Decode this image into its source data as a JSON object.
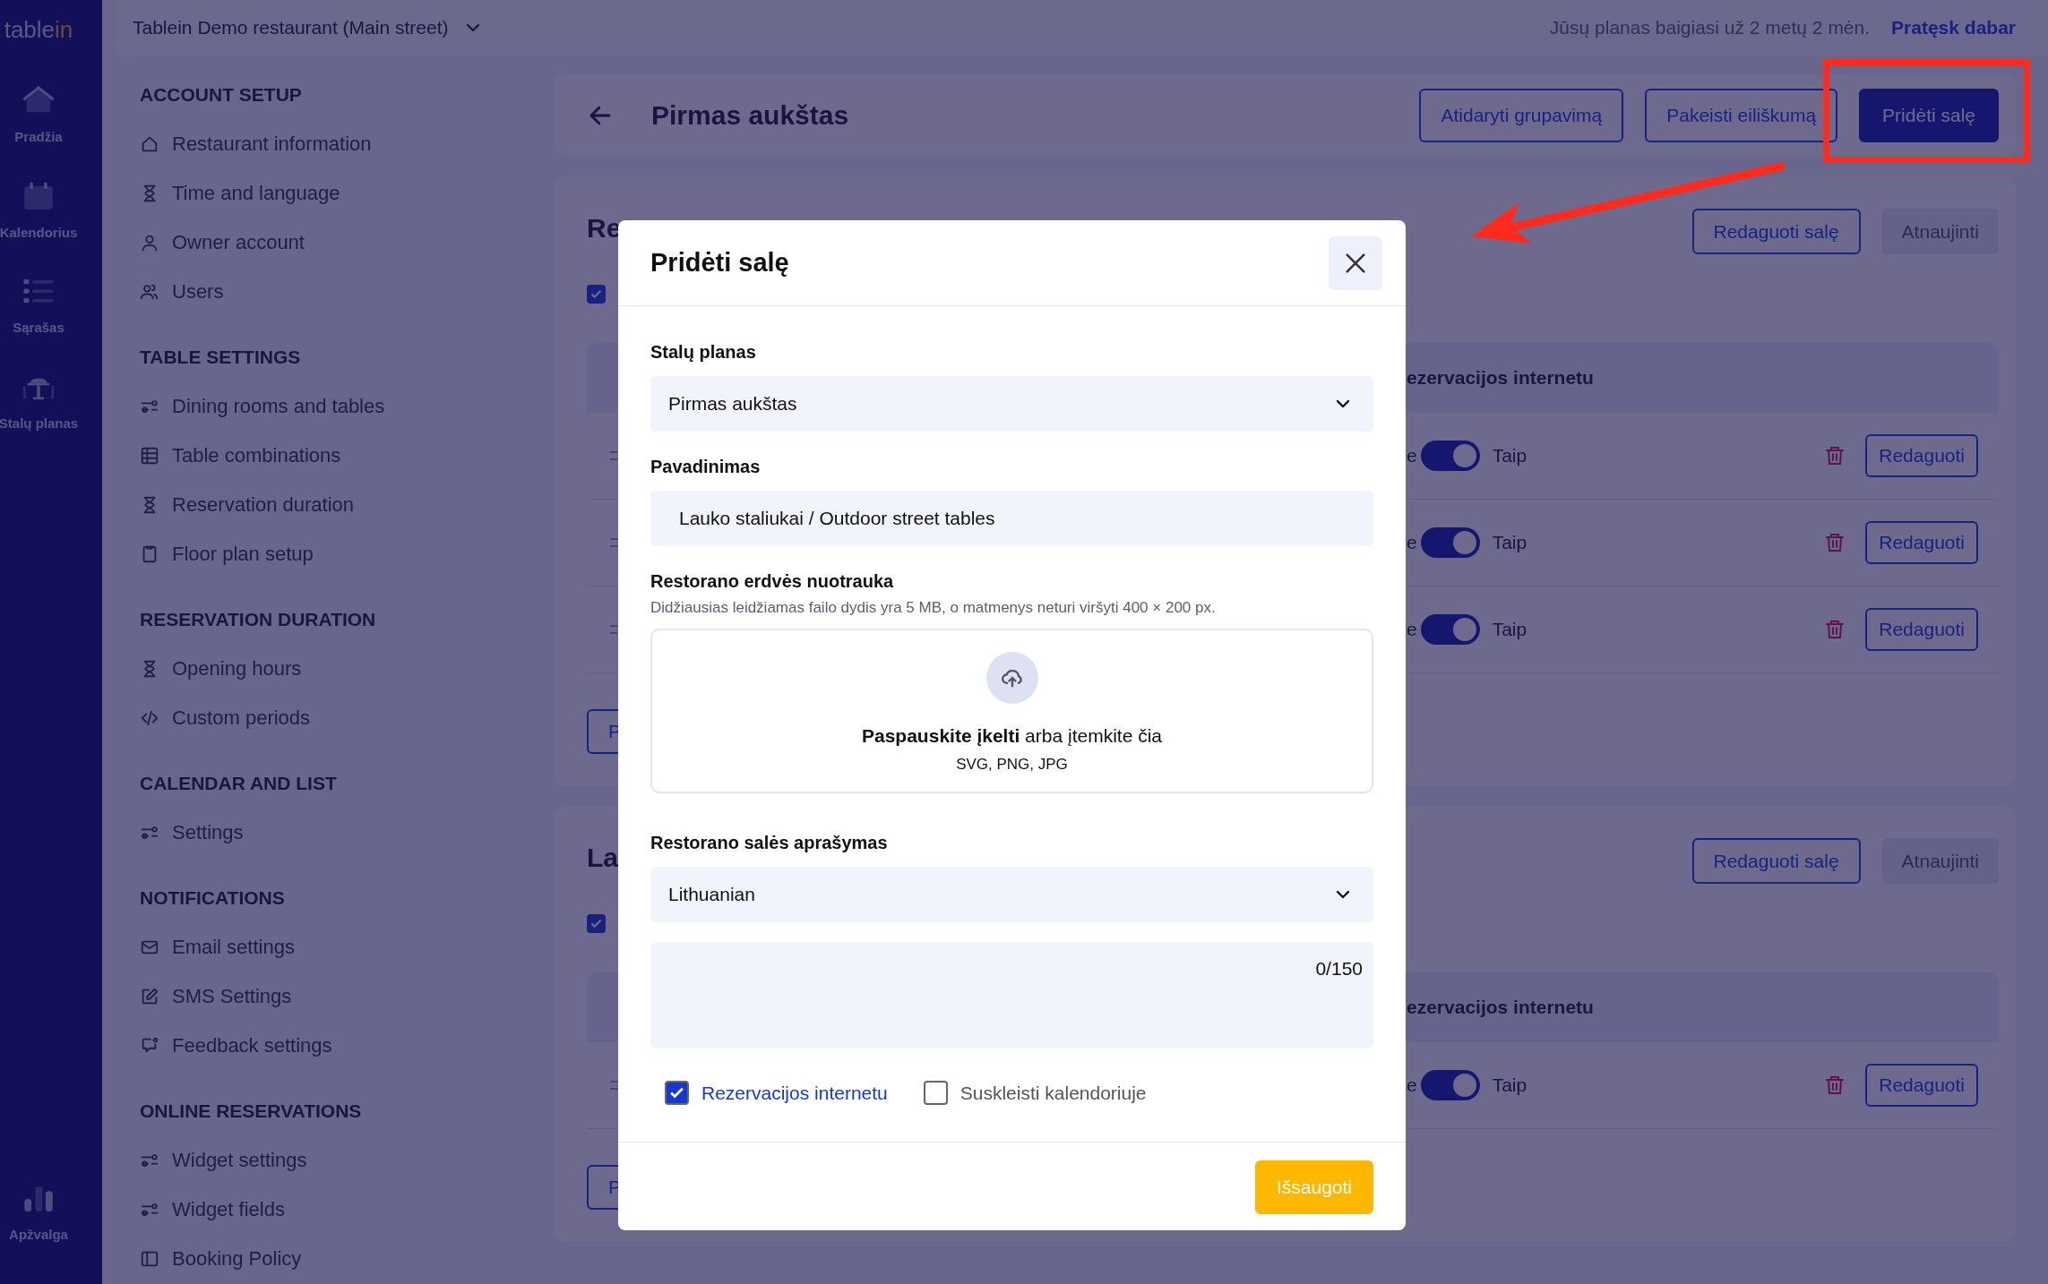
{
  "rail": {
    "logo": "table",
    "logo_accent": "in",
    "items": [
      {
        "kind": "home",
        "label": "Pradžia"
      },
      {
        "kind": "calendar",
        "label": "Kalendorius"
      },
      {
        "kind": "list",
        "label": "Sąrašas"
      },
      {
        "kind": "table",
        "label": "Stalų planas"
      }
    ],
    "bottom_items": [
      {
        "kind": "chart",
        "label": "Apžvalga"
      }
    ]
  },
  "topbar": {
    "restaurant": "Tablein Demo restaurant (Main street)",
    "plan_notice": "Jūsų planas baigiasi už 2 metų 2 mėn.",
    "renew_link": "Pratęsk dabar"
  },
  "settings_menu": [
    {
      "heading": "ACCOUNT SETUP",
      "items": [
        {
          "kind": "home",
          "label": "Restaurant information"
        },
        {
          "kind": "hourglass",
          "label": "Time and language"
        },
        {
          "kind": "user",
          "label": "Owner account"
        },
        {
          "kind": "users",
          "label": "Users"
        }
      ]
    },
    {
      "heading": "TABLE SETTINGS",
      "items": [
        {
          "kind": "sliders",
          "label": "Dining rooms and tables"
        },
        {
          "kind": "grid",
          "label": "Table combinations"
        },
        {
          "kind": "hourglass",
          "label": "Reservation duration"
        },
        {
          "kind": "clipboard",
          "label": "Floor plan setup"
        }
      ]
    },
    {
      "heading": "RESERVATION DURATION",
      "items": [
        {
          "kind": "hourglass",
          "label": "Opening hours"
        },
        {
          "kind": "code",
          "label": "Custom periods"
        }
      ]
    },
    {
      "heading": "CALENDAR AND LIST",
      "items": [
        {
          "kind": "sliders",
          "label": "Settings"
        }
      ]
    },
    {
      "heading": "NOTIFICATIONS",
      "items": [
        {
          "kind": "mail",
          "label": "Email settings"
        },
        {
          "kind": "edit",
          "label": "SMS Settings"
        },
        {
          "kind": "chat",
          "label": "Feedback settings"
        }
      ]
    },
    {
      "heading": "ONLINE RESERVATIONS",
      "items": [
        {
          "kind": "sliders",
          "label": "Widget settings"
        },
        {
          "kind": "sliders",
          "label": "Widget fields"
        },
        {
          "kind": "panel",
          "label": "Booking Policy"
        }
      ]
    }
  ],
  "header": {
    "title": "Pirmas aukštas",
    "buttons": [
      {
        "label": "Atidaryti grupavimą",
        "kind": "outline"
      },
      {
        "label": "Pakeisti eiliškumą",
        "kind": "outline"
      },
      {
        "label": "Pridėti salę",
        "kind": "primary"
      }
    ]
  },
  "rooms": [
    {
      "title": "Re",
      "checked": true,
      "buttons": [
        {
          "label": "Redaguoti salę",
          "disabled": false
        },
        {
          "label": "Atnaujinti",
          "disabled": true
        }
      ],
      "column_header": "ezervacijos internetu",
      "rows": [
        {
          "fragment": "e",
          "on": true,
          "on_label": "Taip",
          "edit": "Redaguoti"
        },
        {
          "fragment": "e",
          "on": true,
          "on_label": "Taip",
          "edit": "Redaguoti"
        },
        {
          "fragment": "e",
          "on": true,
          "on_label": "Taip",
          "edit": "Redaguoti"
        }
      ],
      "footer_button": "P"
    },
    {
      "title": "La",
      "checked": true,
      "buttons": [
        {
          "label": "Redaguoti salę",
          "disabled": false
        },
        {
          "label": "Atnaujinti",
          "disabled": true
        }
      ],
      "column_header": "ezervacijos internetu",
      "rows": [
        {
          "fragment": "e",
          "on": true,
          "on_label": "Taip",
          "edit": "Redaguoti"
        }
      ],
      "footer_button": "P"
    }
  ],
  "modal": {
    "title": "Pridėti salę",
    "plan_label": "Stalų planas",
    "plan_value": "Pirmas aukštas",
    "name_label": "Pavadinimas",
    "name_value": "Lauko staliukai / Outdoor street tables",
    "photo_label": "Restorano erdvės nuotrauka",
    "photo_hint": "Didžiausias leidžiamas failo dydis yra 5 MB, o matmenys neturi viršyti 400 × 200 px.",
    "upload_link": "Paspauskite įkelti",
    "upload_text": " arba įtemkite čia",
    "upload_formats": "SVG, PNG, JPG",
    "description_label": "Restorano salės aprašymas",
    "language_value": "Lithuanian",
    "counter": "0/150",
    "checkboxes": [
      {
        "label": "Rezervacijos internetu",
        "checked": true
      },
      {
        "label": "Suskleisti kalendoriuje",
        "checked": false
      }
    ],
    "save": "Išsaugoti"
  }
}
